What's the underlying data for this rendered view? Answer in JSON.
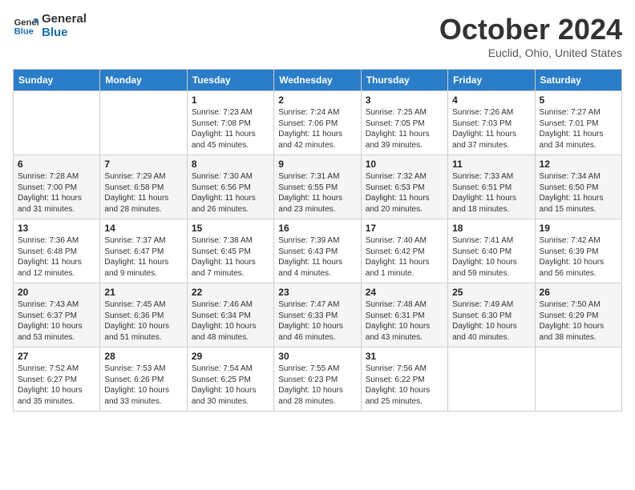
{
  "logo": {
    "line1": "General",
    "line2": "Blue"
  },
  "title": "October 2024",
  "subtitle": "Euclid, Ohio, United States",
  "days_header": [
    "Sunday",
    "Monday",
    "Tuesday",
    "Wednesday",
    "Thursday",
    "Friday",
    "Saturday"
  ],
  "weeks": [
    [
      {
        "num": "",
        "info": ""
      },
      {
        "num": "",
        "info": ""
      },
      {
        "num": "1",
        "info": "Sunrise: 7:23 AM\nSunset: 7:08 PM\nDaylight: 11 hours\nand 45 minutes."
      },
      {
        "num": "2",
        "info": "Sunrise: 7:24 AM\nSunset: 7:06 PM\nDaylight: 11 hours\nand 42 minutes."
      },
      {
        "num": "3",
        "info": "Sunrise: 7:25 AM\nSunset: 7:05 PM\nDaylight: 11 hours\nand 39 minutes."
      },
      {
        "num": "4",
        "info": "Sunrise: 7:26 AM\nSunset: 7:03 PM\nDaylight: 11 hours\nand 37 minutes."
      },
      {
        "num": "5",
        "info": "Sunrise: 7:27 AM\nSunset: 7:01 PM\nDaylight: 11 hours\nand 34 minutes."
      }
    ],
    [
      {
        "num": "6",
        "info": "Sunrise: 7:28 AM\nSunset: 7:00 PM\nDaylight: 11 hours\nand 31 minutes."
      },
      {
        "num": "7",
        "info": "Sunrise: 7:29 AM\nSunset: 6:58 PM\nDaylight: 11 hours\nand 28 minutes."
      },
      {
        "num": "8",
        "info": "Sunrise: 7:30 AM\nSunset: 6:56 PM\nDaylight: 11 hours\nand 26 minutes."
      },
      {
        "num": "9",
        "info": "Sunrise: 7:31 AM\nSunset: 6:55 PM\nDaylight: 11 hours\nand 23 minutes."
      },
      {
        "num": "10",
        "info": "Sunrise: 7:32 AM\nSunset: 6:53 PM\nDaylight: 11 hours\nand 20 minutes."
      },
      {
        "num": "11",
        "info": "Sunrise: 7:33 AM\nSunset: 6:51 PM\nDaylight: 11 hours\nand 18 minutes."
      },
      {
        "num": "12",
        "info": "Sunrise: 7:34 AM\nSunset: 6:50 PM\nDaylight: 11 hours\nand 15 minutes."
      }
    ],
    [
      {
        "num": "13",
        "info": "Sunrise: 7:36 AM\nSunset: 6:48 PM\nDaylight: 11 hours\nand 12 minutes."
      },
      {
        "num": "14",
        "info": "Sunrise: 7:37 AM\nSunset: 6:47 PM\nDaylight: 11 hours\nand 9 minutes."
      },
      {
        "num": "15",
        "info": "Sunrise: 7:38 AM\nSunset: 6:45 PM\nDaylight: 11 hours\nand 7 minutes."
      },
      {
        "num": "16",
        "info": "Sunrise: 7:39 AM\nSunset: 6:43 PM\nDaylight: 11 hours\nand 4 minutes."
      },
      {
        "num": "17",
        "info": "Sunrise: 7:40 AM\nSunset: 6:42 PM\nDaylight: 11 hours\nand 1 minute."
      },
      {
        "num": "18",
        "info": "Sunrise: 7:41 AM\nSunset: 6:40 PM\nDaylight: 10 hours\nand 59 minutes."
      },
      {
        "num": "19",
        "info": "Sunrise: 7:42 AM\nSunset: 6:39 PM\nDaylight: 10 hours\nand 56 minutes."
      }
    ],
    [
      {
        "num": "20",
        "info": "Sunrise: 7:43 AM\nSunset: 6:37 PM\nDaylight: 10 hours\nand 53 minutes."
      },
      {
        "num": "21",
        "info": "Sunrise: 7:45 AM\nSunset: 6:36 PM\nDaylight: 10 hours\nand 51 minutes."
      },
      {
        "num": "22",
        "info": "Sunrise: 7:46 AM\nSunset: 6:34 PM\nDaylight: 10 hours\nand 48 minutes."
      },
      {
        "num": "23",
        "info": "Sunrise: 7:47 AM\nSunset: 6:33 PM\nDaylight: 10 hours\nand 46 minutes."
      },
      {
        "num": "24",
        "info": "Sunrise: 7:48 AM\nSunset: 6:31 PM\nDaylight: 10 hours\nand 43 minutes."
      },
      {
        "num": "25",
        "info": "Sunrise: 7:49 AM\nSunset: 6:30 PM\nDaylight: 10 hours\nand 40 minutes."
      },
      {
        "num": "26",
        "info": "Sunrise: 7:50 AM\nSunset: 6:29 PM\nDaylight: 10 hours\nand 38 minutes."
      }
    ],
    [
      {
        "num": "27",
        "info": "Sunrise: 7:52 AM\nSunset: 6:27 PM\nDaylight: 10 hours\nand 35 minutes."
      },
      {
        "num": "28",
        "info": "Sunrise: 7:53 AM\nSunset: 6:26 PM\nDaylight: 10 hours\nand 33 minutes."
      },
      {
        "num": "29",
        "info": "Sunrise: 7:54 AM\nSunset: 6:25 PM\nDaylight: 10 hours\nand 30 minutes."
      },
      {
        "num": "30",
        "info": "Sunrise: 7:55 AM\nSunset: 6:23 PM\nDaylight: 10 hours\nand 28 minutes."
      },
      {
        "num": "31",
        "info": "Sunrise: 7:56 AM\nSunset: 6:22 PM\nDaylight: 10 hours\nand 25 minutes."
      },
      {
        "num": "",
        "info": ""
      },
      {
        "num": "",
        "info": ""
      }
    ]
  ]
}
